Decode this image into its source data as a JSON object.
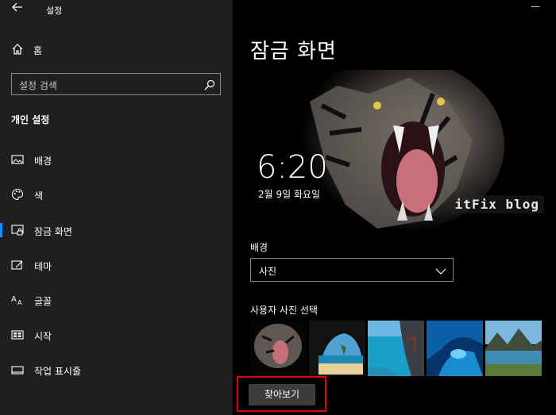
{
  "window": {
    "title": "설정",
    "back_icon": "back-arrow-icon",
    "minimize_label": "—"
  },
  "sidebar": {
    "home_label": "홈",
    "search_placeholder": "설정 검색",
    "section_title": "개인 설정",
    "items": [
      {
        "label": "배경",
        "icon": "picture-icon",
        "selected": false
      },
      {
        "label": "색",
        "icon": "palette-icon",
        "selected": false
      },
      {
        "label": "잠금 화면",
        "icon": "lock-screen-icon",
        "selected": true
      },
      {
        "label": "테마",
        "icon": "theme-icon",
        "selected": false
      },
      {
        "label": "글꼴",
        "icon": "font-icon",
        "selected": false
      },
      {
        "label": "시작",
        "icon": "start-icon",
        "selected": false
      },
      {
        "label": "작업 표시줄",
        "icon": "taskbar-icon",
        "selected": false
      }
    ],
    "accent_color": "#1a8cff"
  },
  "main": {
    "title": "잠금 화면",
    "preview": {
      "time": "6:20",
      "date": "2월 9일 화요일",
      "watermark": "itFix blog"
    },
    "background_label": "배경",
    "background_value": "사진",
    "pick_label": "사용자 사진 선택",
    "thumbnails": [
      "tiger",
      "beach-cave",
      "seaside-cliff",
      "ice-cave",
      "mountain-lake"
    ],
    "browse_label": "찾아보기",
    "highlight_color": "#e00000"
  }
}
